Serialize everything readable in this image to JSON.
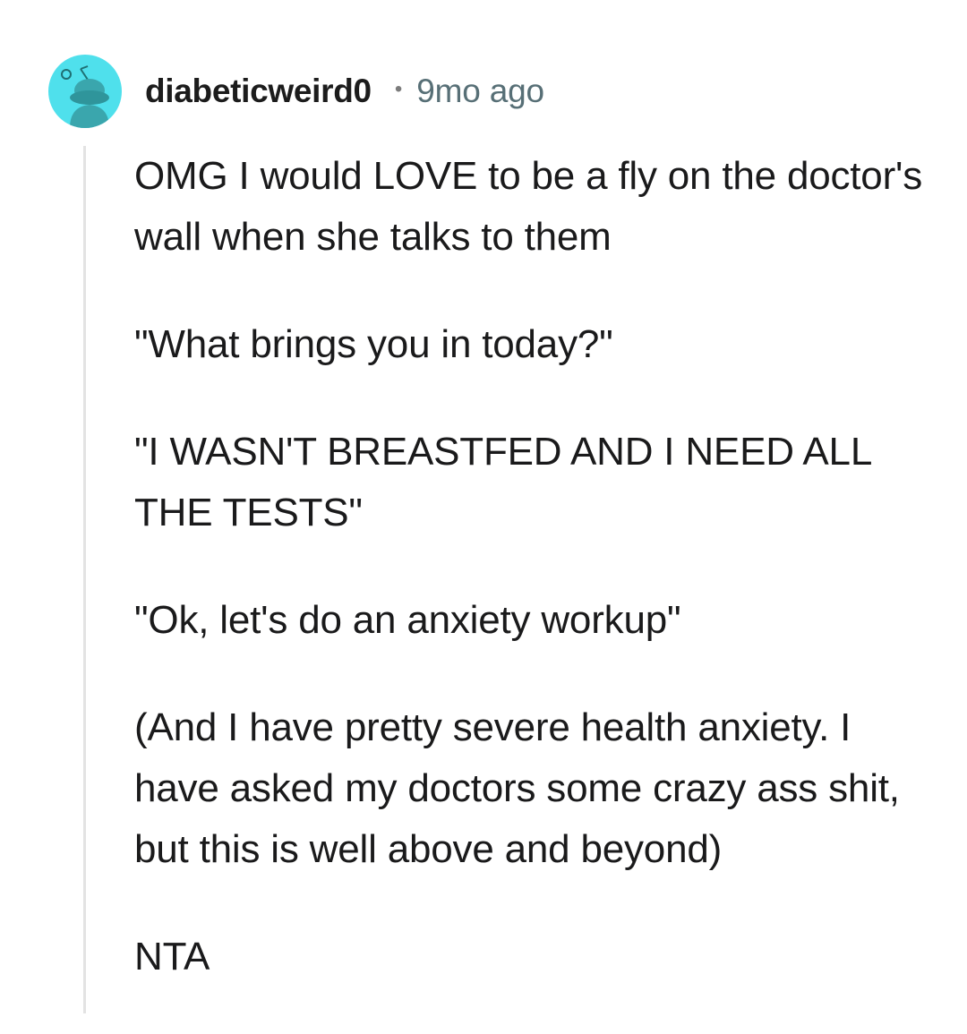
{
  "comment": {
    "author": "diabeticweird0",
    "separator": "•",
    "timestamp": "9mo ago",
    "avatar_icon": "reddit-snoo-avatar-icon",
    "avatar_color": "#4fe0ec",
    "paragraphs": [
      "OMG I would LOVE to be a fly on the doctor's wall when she talks to them",
      "\"What brings you in today?\"",
      "\"I WASN'T BREASTFED AND I NEED ALL THE TESTS\"",
      "\"Ok, let's do an anxiety workup\"",
      "(And I have pretty severe health anxiety. I have asked my doctors some crazy ass shit, but this is well above and beyond)",
      "NTA"
    ]
  }
}
